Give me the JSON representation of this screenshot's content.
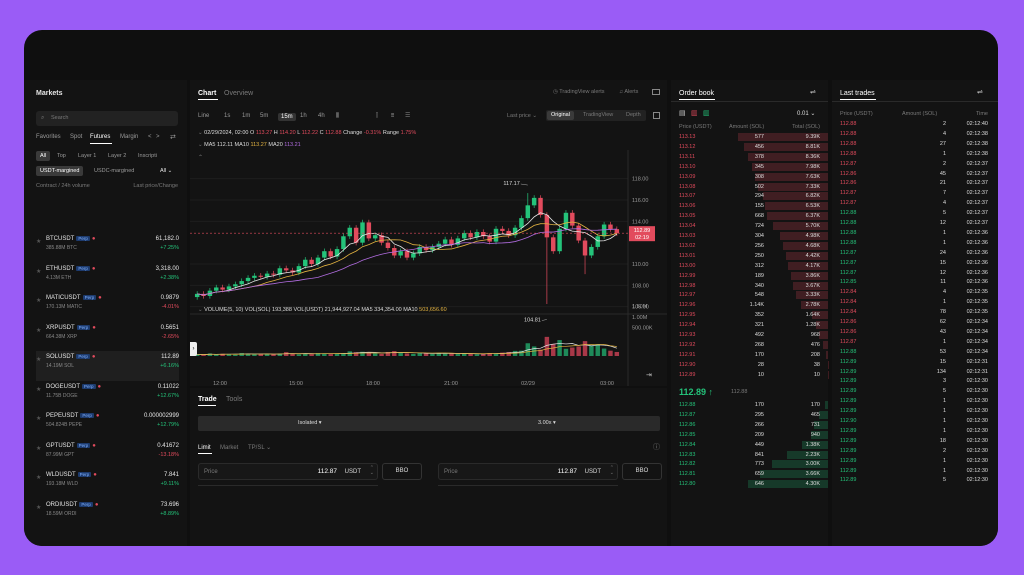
{
  "markets": {
    "title": "Markets",
    "search_placeholder": "Search",
    "tabs": [
      "Favorites",
      "Spot",
      "Futures",
      "Margin",
      "<",
      ">"
    ],
    "subtabs": [
      "All",
      "Top",
      "Layer 1",
      "Layer 2",
      "Inscripti"
    ],
    "filters": [
      "USDT-margined",
      "USDC-margined",
      "All"
    ],
    "col_left": "Contract / 24h volume",
    "col_right": "Last price/Change",
    "badge": "Perp",
    "rows": [
      {
        "sym": "BTCUSDT",
        "vol": "385.88M BTC",
        "price": "61,182.0",
        "chg": "+7.25%",
        "up": true
      },
      {
        "sym": "ETHUSDT",
        "vol": "4.13M ETH",
        "price": "3,318.00",
        "chg": "+2.38%",
        "up": true
      },
      {
        "sym": "MATICUSDT",
        "vol": "170.13M MATIC",
        "price": "0.9879",
        "chg": "-4.01%",
        "up": false
      },
      {
        "sym": "XRPUSDT",
        "vol": "664.38M XRP",
        "price": "0.5651",
        "chg": "-2.65%",
        "up": false
      },
      {
        "sym": "SOLUSDT",
        "vol": "14.19M SOL",
        "price": "112.89",
        "chg": "+6.16%",
        "up": true
      },
      {
        "sym": "DOGEUSDT",
        "vol": "11.75B DOGE",
        "price": "0.11022",
        "chg": "+12.67%",
        "up": true
      },
      {
        "sym": "PEPEUSDT",
        "vol": "504.824B PEPE",
        "price": "0.000002999",
        "chg": "+12.79%",
        "up": true
      },
      {
        "sym": "GPTUSDT",
        "vol": "87.99M GPT",
        "price": "0.41672",
        "chg": "-13.18%",
        "up": false
      },
      {
        "sym": "WLDUSDT",
        "vol": "193.18M WLD",
        "price": "7.841",
        "chg": "+9.11%",
        "up": true
      },
      {
        "sym": "ORDIUSDT",
        "vol": "18.59M ORDI",
        "price": "73.696",
        "chg": "+8.89%",
        "up": true
      }
    ]
  },
  "chart": {
    "tabs": [
      "Chart",
      "Overview"
    ],
    "tv_alerts": "TradingView alerts",
    "alerts": "Alerts",
    "intervals": [
      "Line",
      "1s",
      "1m",
      "5m",
      "15m",
      "1h",
      "4h"
    ],
    "last_price": "Last price",
    "views": [
      "Original",
      "TradingView",
      "Depth"
    ],
    "ohlc": {
      "date": "02/29/2024, 02:00",
      "o_lbl": "O",
      "o": "113.27",
      "h_lbl": "H",
      "h": "114.20",
      "l_lbl": "L",
      "l": "112.22",
      "c_lbl": "C",
      "c": "112.88",
      "chg_lbl": "Change",
      "chg": "-0.31%",
      "rng_lbl": "Range",
      "rng": "1.75%"
    },
    "ma": {
      "ma5_lbl": "MA5",
      "ma5": "112.11",
      "ma10_lbl": "MA10",
      "ma10": "113.27",
      "ma20_lbl": "MA20",
      "ma20": "113.21"
    },
    "high_label": "117.17",
    "low_label": "104.81",
    "price_ticks": [
      "118.00",
      "116.00",
      "114.00",
      "110.00",
      "108.00",
      "106.00"
    ],
    "current_price": "112.89",
    "countdown": "02:19",
    "vol": {
      "lbl": "VOLUME(5, 10)",
      "v_lbl": "VOL(SOL)",
      "v": "193,388",
      "vu_lbl": "VOL(USDT)",
      "vu": "21,944,927.04",
      "m5_lbl": "MA5",
      "m5": "334,354.00",
      "m10_lbl": "MA10",
      "m10": "503,656.60"
    },
    "vol_ticks": [
      "1.50M",
      "1.00M",
      "500.00K"
    ],
    "time_ticks": [
      "12:00",
      "15:00",
      "18:00",
      "21:00",
      "02/29",
      "03:00"
    ]
  },
  "chart_data": {
    "type": "candlestick",
    "ylim": [
      104,
      119
    ],
    "close": [
      107.2,
      107.0,
      107.5,
      107.8,
      107.6,
      107.9,
      108.1,
      108.4,
      108.7,
      108.9,
      108.8,
      109.1,
      109.0,
      109.6,
      109.4,
      109.2,
      109.8,
      110.4,
      110.0,
      110.6,
      111.2,
      110.7,
      111.4,
      112.6,
      113.4,
      112.0,
      113.9,
      112.4,
      112.7,
      112.0,
      111.5,
      110.8,
      111.2,
      110.6,
      111.0,
      111.6,
      111.3,
      111.6,
      111.9,
      112.3,
      111.8,
      112.4,
      112.9,
      112.5,
      113.0,
      112.6,
      112.1,
      113.3,
      113.1,
      112.7,
      113.4,
      114.3,
      115.5,
      116.2,
      114.6,
      112.5,
      111.2,
      113.3,
      114.8,
      113.6,
      112.2,
      110.8,
      111.6,
      112.6,
      113.7,
      113.27,
      112.88
    ],
    "volume_m": [
      0.08,
      0.05,
      0.12,
      0.07,
      0.1,
      0.09,
      0.06,
      0.14,
      0.11,
      0.08,
      0.1,
      0.09,
      0.07,
      0.12,
      0.18,
      0.1,
      0.08,
      0.11,
      0.09,
      0.14,
      0.12,
      0.09,
      0.1,
      0.13,
      0.22,
      0.18,
      0.2,
      0.15,
      0.12,
      0.1,
      0.19,
      0.23,
      0.14,
      0.12,
      0.1,
      0.16,
      0.12,
      0.1,
      0.14,
      0.11,
      0.13,
      0.09,
      0.12,
      0.1,
      0.08,
      0.11,
      0.14,
      0.12,
      0.16,
      0.19,
      0.24,
      0.25,
      0.6,
      0.45,
      0.3,
      0.9,
      0.55,
      0.75,
      0.34,
      0.4,
      0.45,
      0.7,
      0.5,
      0.55,
      0.35,
      0.25,
      0.19
    ]
  },
  "trade": {
    "tabs": [
      "Trade",
      "Tools"
    ],
    "margin_mode": "Isolated",
    "leverage": "3.00x",
    "order_types": [
      "Limit",
      "Market",
      "TP/SL"
    ],
    "price_lbl": "Price",
    "price_val": "112.87",
    "unit": "USDT",
    "bbo": "BBO"
  },
  "orderbook": {
    "title": "Order book",
    "precision": "0.01",
    "cols": [
      "Price (USDT)",
      "Amount (SOL)",
      "Total (SOL)"
    ],
    "asks": [
      [
        "113.13",
        "577",
        "9.39K"
      ],
      [
        "113.12",
        "456",
        "8.81K"
      ],
      [
        "113.11",
        "378",
        "8.36K"
      ],
      [
        "113.10",
        "345",
        "7.98K"
      ],
      [
        "113.09",
        "308",
        "7.63K"
      ],
      [
        "113.08",
        "502",
        "7.33K"
      ],
      [
        "113.07",
        "294",
        "6.82K"
      ],
      [
        "113.06",
        "155",
        "6.53K"
      ],
      [
        "113.05",
        "668",
        "6.37K"
      ],
      [
        "113.04",
        "724",
        "5.70K"
      ],
      [
        "113.03",
        "304",
        "4.98K"
      ],
      [
        "113.02",
        "256",
        "4.68K"
      ],
      [
        "113.01",
        "250",
        "4.42K"
      ],
      [
        "113.00",
        "312",
        "4.17K"
      ],
      [
        "112.99",
        "189",
        "3.86K"
      ],
      [
        "112.98",
        "340",
        "3.67K"
      ],
      [
        "112.97",
        "548",
        "3.33K"
      ],
      [
        "112.96",
        "1.14K",
        "2.78K"
      ],
      [
        "112.95",
        "352",
        "1.64K"
      ],
      [
        "112.94",
        "321",
        "1.28K"
      ],
      [
        "112.93",
        "492",
        "968"
      ],
      [
        "112.92",
        "268",
        "476"
      ],
      [
        "112.91",
        "170",
        "208"
      ],
      [
        "112.90",
        "28",
        "38"
      ],
      [
        "112.89",
        "10",
        "10"
      ]
    ],
    "mid_price": "112.89",
    "mid_arrow": "↑",
    "mid_mark": "112.88",
    "bids": [
      [
        "112.88",
        "170",
        "170"
      ],
      [
        "112.87",
        "295",
        "465"
      ],
      [
        "112.86",
        "266",
        "731"
      ],
      [
        "112.85",
        "209",
        "940"
      ],
      [
        "112.84",
        "449",
        "1.38K"
      ],
      [
        "112.83",
        "841",
        "2.23K"
      ],
      [
        "112.82",
        "773",
        "3.00K"
      ],
      [
        "112.81",
        "659",
        "3.66K"
      ],
      [
        "112.80",
        "646",
        "4.30K"
      ]
    ]
  },
  "lasttrades": {
    "title": "Last trades",
    "cols": [
      "Price (USDT)",
      "Amount (SOL)",
      "Time"
    ],
    "rows": [
      [
        "112.88",
        "2",
        "02:12:40",
        false
      ],
      [
        "112.88",
        "4",
        "02:12:38",
        false
      ],
      [
        "112.88",
        "27",
        "02:12:38",
        false
      ],
      [
        "112.88",
        "1",
        "02:12:38",
        false
      ],
      [
        "112.87",
        "2",
        "02:12:37",
        false
      ],
      [
        "112.86",
        "45",
        "02:12:37",
        false
      ],
      [
        "112.86",
        "21",
        "02:12:37",
        false
      ],
      [
        "112.87",
        "7",
        "02:12:37",
        false
      ],
      [
        "112.87",
        "4",
        "02:12:37",
        false
      ],
      [
        "112.88",
        "5",
        "02:12:37",
        true
      ],
      [
        "112.88",
        "12",
        "02:12:37",
        true
      ],
      [
        "112.88",
        "1",
        "02:12:36",
        true
      ],
      [
        "112.88",
        "1",
        "02:12:36",
        true
      ],
      [
        "112.87",
        "24",
        "02:12:36",
        true
      ],
      [
        "112.87",
        "15",
        "02:12:36",
        true
      ],
      [
        "112.87",
        "12",
        "02:12:36",
        true
      ],
      [
        "112.85",
        "11",
        "02:12:36",
        true
      ],
      [
        "112.84",
        "4",
        "02:12:35",
        false
      ],
      [
        "112.84",
        "1",
        "02:12:35",
        false
      ],
      [
        "112.84",
        "78",
        "02:12:35",
        false
      ],
      [
        "112.86",
        "62",
        "02:12:34",
        false
      ],
      [
        "112.86",
        "43",
        "02:12:34",
        false
      ],
      [
        "112.87",
        "1",
        "02:12:34",
        false
      ],
      [
        "112.88",
        "53",
        "02:12:34",
        true
      ],
      [
        "112.89",
        "15",
        "02:12:31",
        true
      ],
      [
        "112.89",
        "134",
        "02:12:31",
        true
      ],
      [
        "112.89",
        "3",
        "02:12:30",
        true
      ],
      [
        "112.89",
        "5",
        "02:12:30",
        true
      ],
      [
        "112.89",
        "1",
        "02:12:30",
        true
      ],
      [
        "112.89",
        "1",
        "02:12:30",
        true
      ],
      [
        "112.90",
        "1",
        "02:12:30",
        true
      ],
      [
        "112.89",
        "1",
        "02:12:30",
        true
      ],
      [
        "112.89",
        "18",
        "02:12:30",
        true
      ],
      [
        "112.89",
        "2",
        "02:12:30",
        true
      ],
      [
        "112.89",
        "1",
        "02:12:30",
        true
      ],
      [
        "112.89",
        "1",
        "02:12:30",
        true
      ],
      [
        "112.89",
        "5",
        "02:12:30",
        true
      ]
    ]
  }
}
